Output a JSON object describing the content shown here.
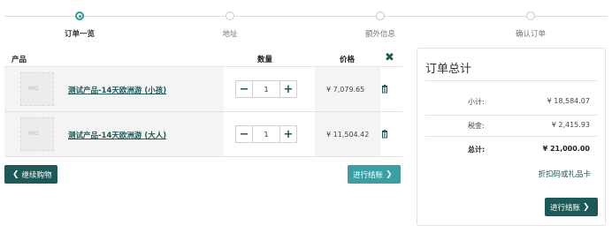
{
  "steps": [
    {
      "label": "订单一览",
      "active": true
    },
    {
      "label": "地址",
      "active": false
    },
    {
      "label": "额外信息",
      "active": false
    },
    {
      "label": "确认订单",
      "active": false
    }
  ],
  "cart": {
    "headers": {
      "product": "产品",
      "quantity": "数量",
      "price": "价格"
    },
    "rows": [
      {
        "name": "测试产品-14天欧洲游 (小孩)",
        "qty": "1",
        "price": "¥ 7,079.65"
      },
      {
        "name": "测试产品-14天欧洲游 (大人)",
        "qty": "1",
        "price": "¥ 11,504.42"
      }
    ],
    "thumb_text": "IMG",
    "continue_label": "继续购物",
    "checkout_label": "进行结账"
  },
  "summary": {
    "title": "订单总计",
    "subtotal_label": "小计:",
    "subtotal_value": "¥ 18,584.07",
    "tax_label": "税金:",
    "tax_value": "¥ 2,415.93",
    "total_label": "总计:",
    "total_value": "¥ 21,000.00",
    "coupon_label": "折扣码或礼品卡",
    "checkout_label": "进行结账"
  },
  "colors": {
    "accent_dark": "#1c5a57",
    "accent_teal": "#3a9ea3",
    "step_active": "#2a9d9a"
  },
  "icons": {
    "remove_all": "close-icon",
    "remove_row": "trash-icon",
    "minus": "minus-icon",
    "plus": "plus-icon"
  }
}
